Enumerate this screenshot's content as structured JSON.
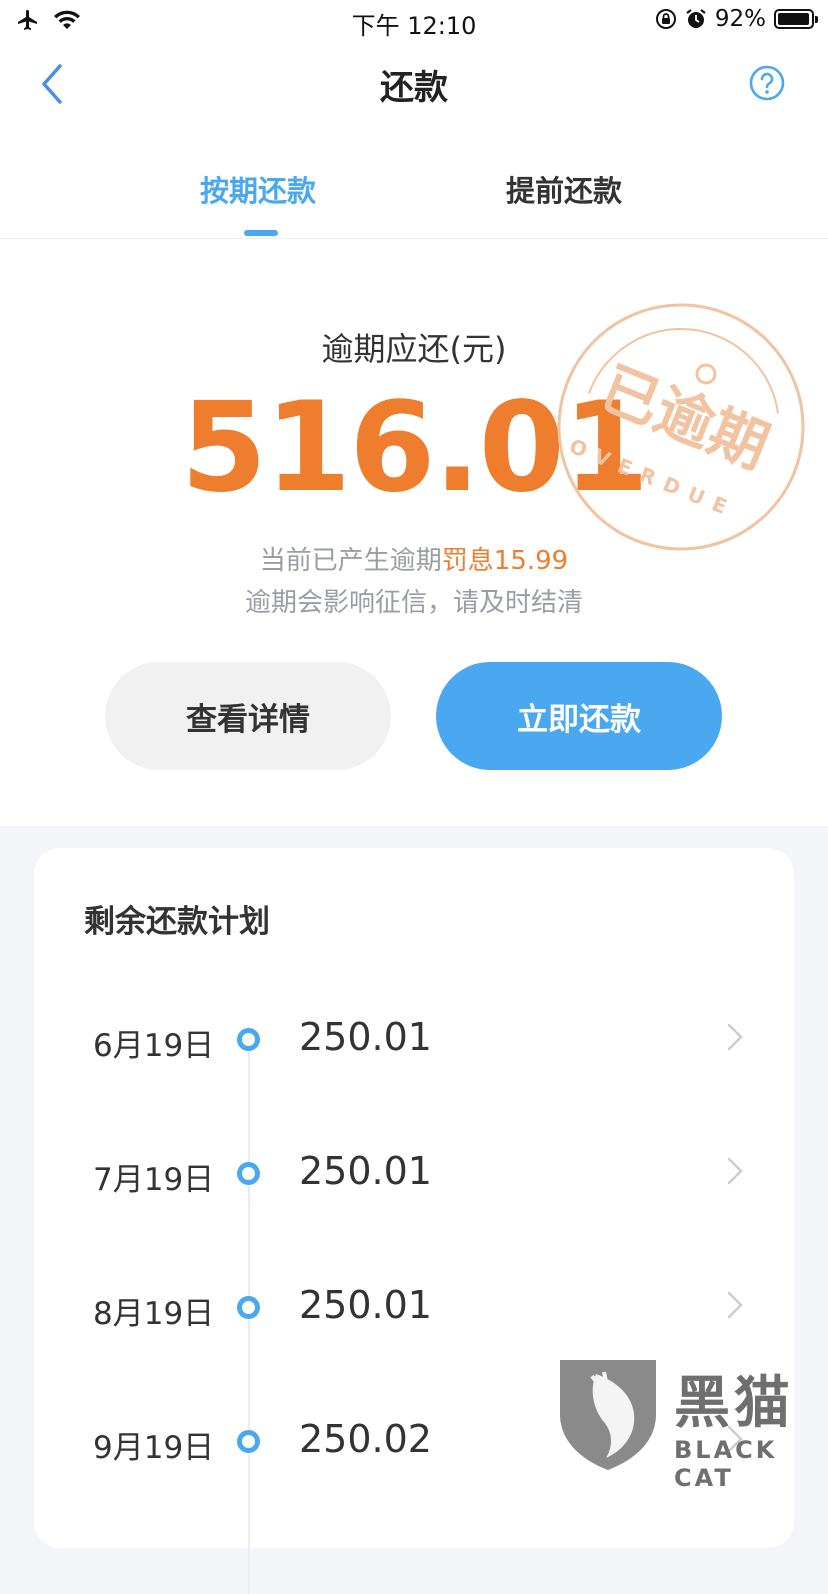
{
  "status_bar": {
    "time": "下午 12:10",
    "battery": "92%"
  },
  "nav": {
    "title": "还款"
  },
  "tabs": [
    {
      "label": "按期还款",
      "active": true
    },
    {
      "label": "提前还款",
      "active": false
    }
  ],
  "overdue": {
    "label": "逾期应还(元)",
    "amount": "516.01",
    "notice_prefix": "当前已产生逾期",
    "notice_highlight": "罚息15.99",
    "notice_line2": "逾期会影响征信，请及时结清",
    "stamp_text": "已逾期",
    "stamp_subtext": "OVERDUE"
  },
  "buttons": {
    "detail": "查看详情",
    "repay_now": "立即还款"
  },
  "plan": {
    "title": "剩余还款计划",
    "items": [
      {
        "date": "6月19日",
        "amount": "250.01"
      },
      {
        "date": "7月19日",
        "amount": "250.01"
      },
      {
        "date": "8月19日",
        "amount": "250.01"
      },
      {
        "date": "9月19日",
        "amount": "250.02"
      }
    ]
  },
  "watermark": {
    "zh": "黑猫",
    "en": "BLACK CAT"
  },
  "colors": {
    "accent_blue": "#4aa8f0",
    "overdue_orange": "#ef7d2e",
    "stamp": "#f2c3a0"
  }
}
